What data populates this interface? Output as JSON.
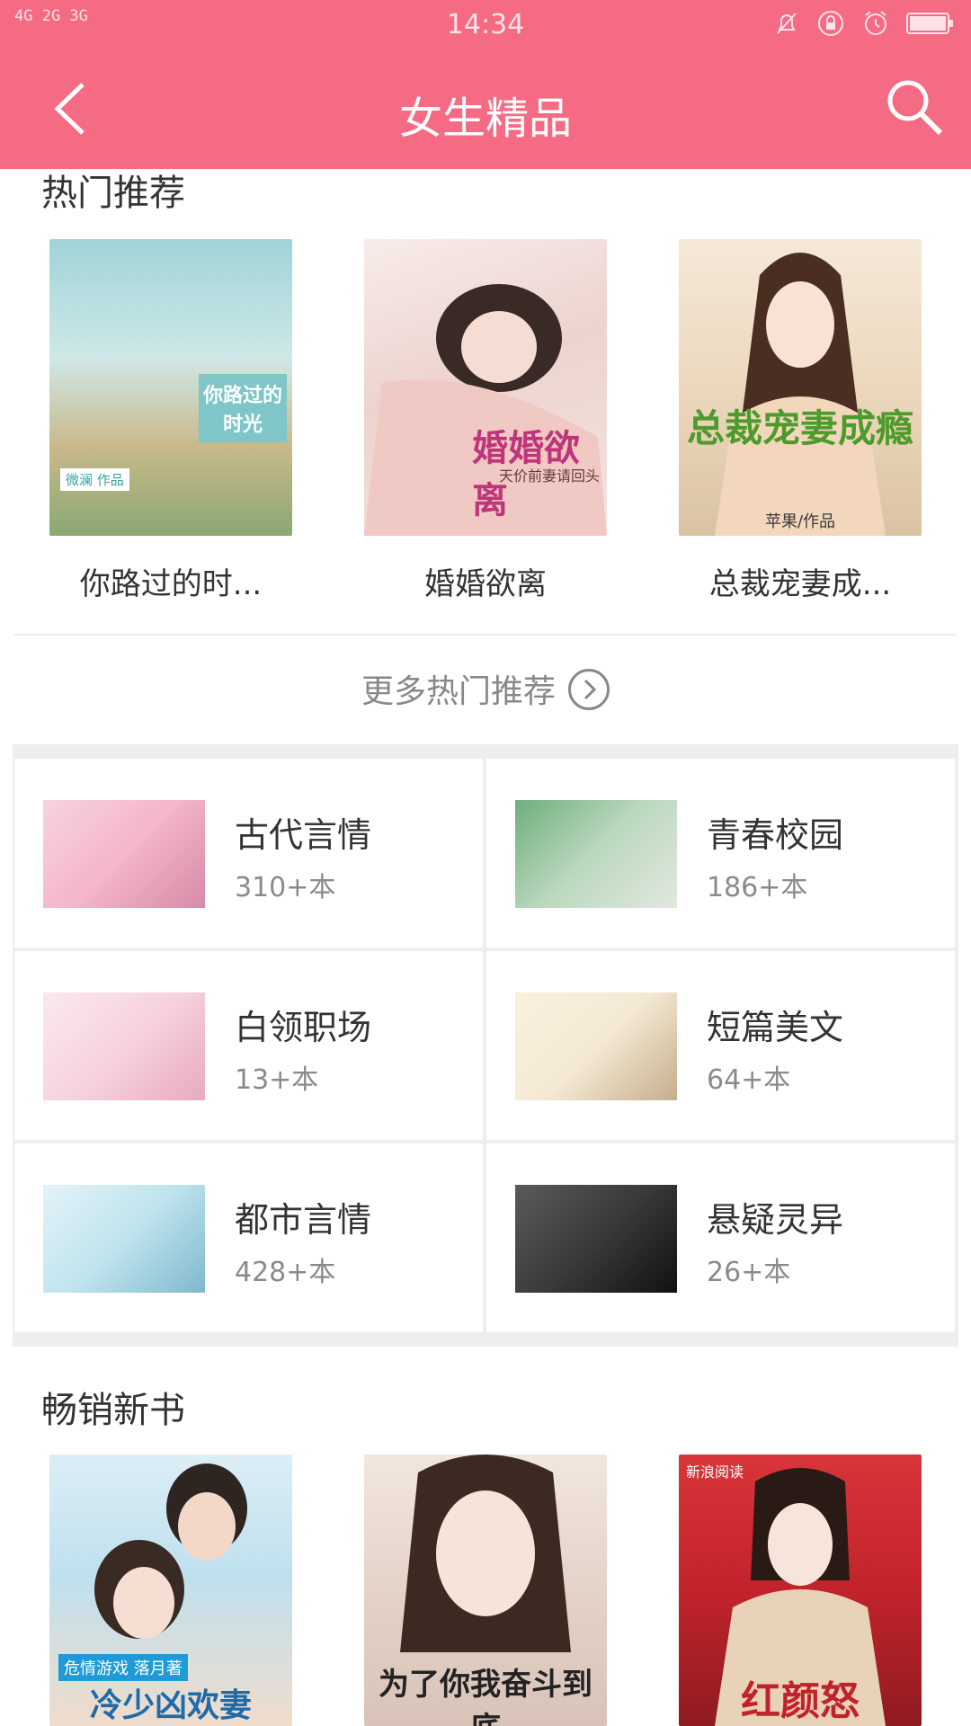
{
  "status_bar": {
    "network": "4G 2G 3G",
    "time": "14:34"
  },
  "header": {
    "title": "女生精品"
  },
  "hot": {
    "title": "热门推荐",
    "books": [
      {
        "title": "你路过的时...",
        "cover_text": "你路过的时光",
        "cover_sub": "微澜 作品",
        "cover_colors": [
          "#9fd4d8",
          "#c9b98a"
        ]
      },
      {
        "title": "婚婚欲离",
        "cover_text": "婚婚欲离",
        "cover_sub": "天价前妻请回头",
        "cover_colors": [
          "#f3e4e0",
          "#e7c6c1"
        ]
      },
      {
        "title": "总裁宠妻成...",
        "cover_text": "总裁宠妻成瘾",
        "cover_sub": "苹果/作品",
        "cover_colors": [
          "#f2e3cf",
          "#d9c3a3"
        ]
      }
    ],
    "more_label": "更多热门推荐"
  },
  "categories": [
    {
      "name": "古代言情",
      "count": "310+本",
      "colors": [
        "#f4b6c8",
        "#d78aa8"
      ]
    },
    {
      "name": "青春校园",
      "count": "186+本",
      "colors": [
        "#8cc39a",
        "#e2e8e0"
      ]
    },
    {
      "name": "白领职场",
      "count": "13+本",
      "colors": [
        "#f6d2df",
        "#e9aac0"
      ]
    },
    {
      "name": "短篇美文",
      "count": "64+本",
      "colors": [
        "#f4ead4",
        "#c6ad8c"
      ]
    },
    {
      "name": "都市言情",
      "count": "428+本",
      "colors": [
        "#bfe4ee",
        "#7fb8cc"
      ]
    },
    {
      "name": "悬疑灵异",
      "count": "26+本",
      "colors": [
        "#3a3a3a",
        "#111111"
      ]
    }
  ],
  "bestseller": {
    "title": "畅销新书",
    "books": [
      {
        "cover_text": "冷少凶欢妻",
        "cover_sub": "危情游戏 落月著",
        "cover_colors": [
          "#bfe0ee",
          "#f0dccc"
        ]
      },
      {
        "cover_text": "为了你我奋斗到底",
        "cover_sub": "",
        "cover_colors": [
          "#d9c3b8",
          "#f1e6df"
        ]
      },
      {
        "cover_text": "红颜怒",
        "cover_sub": "新浪阅读",
        "cover_colors": [
          "#c2232b",
          "#8e1b1f"
        ]
      }
    ]
  }
}
